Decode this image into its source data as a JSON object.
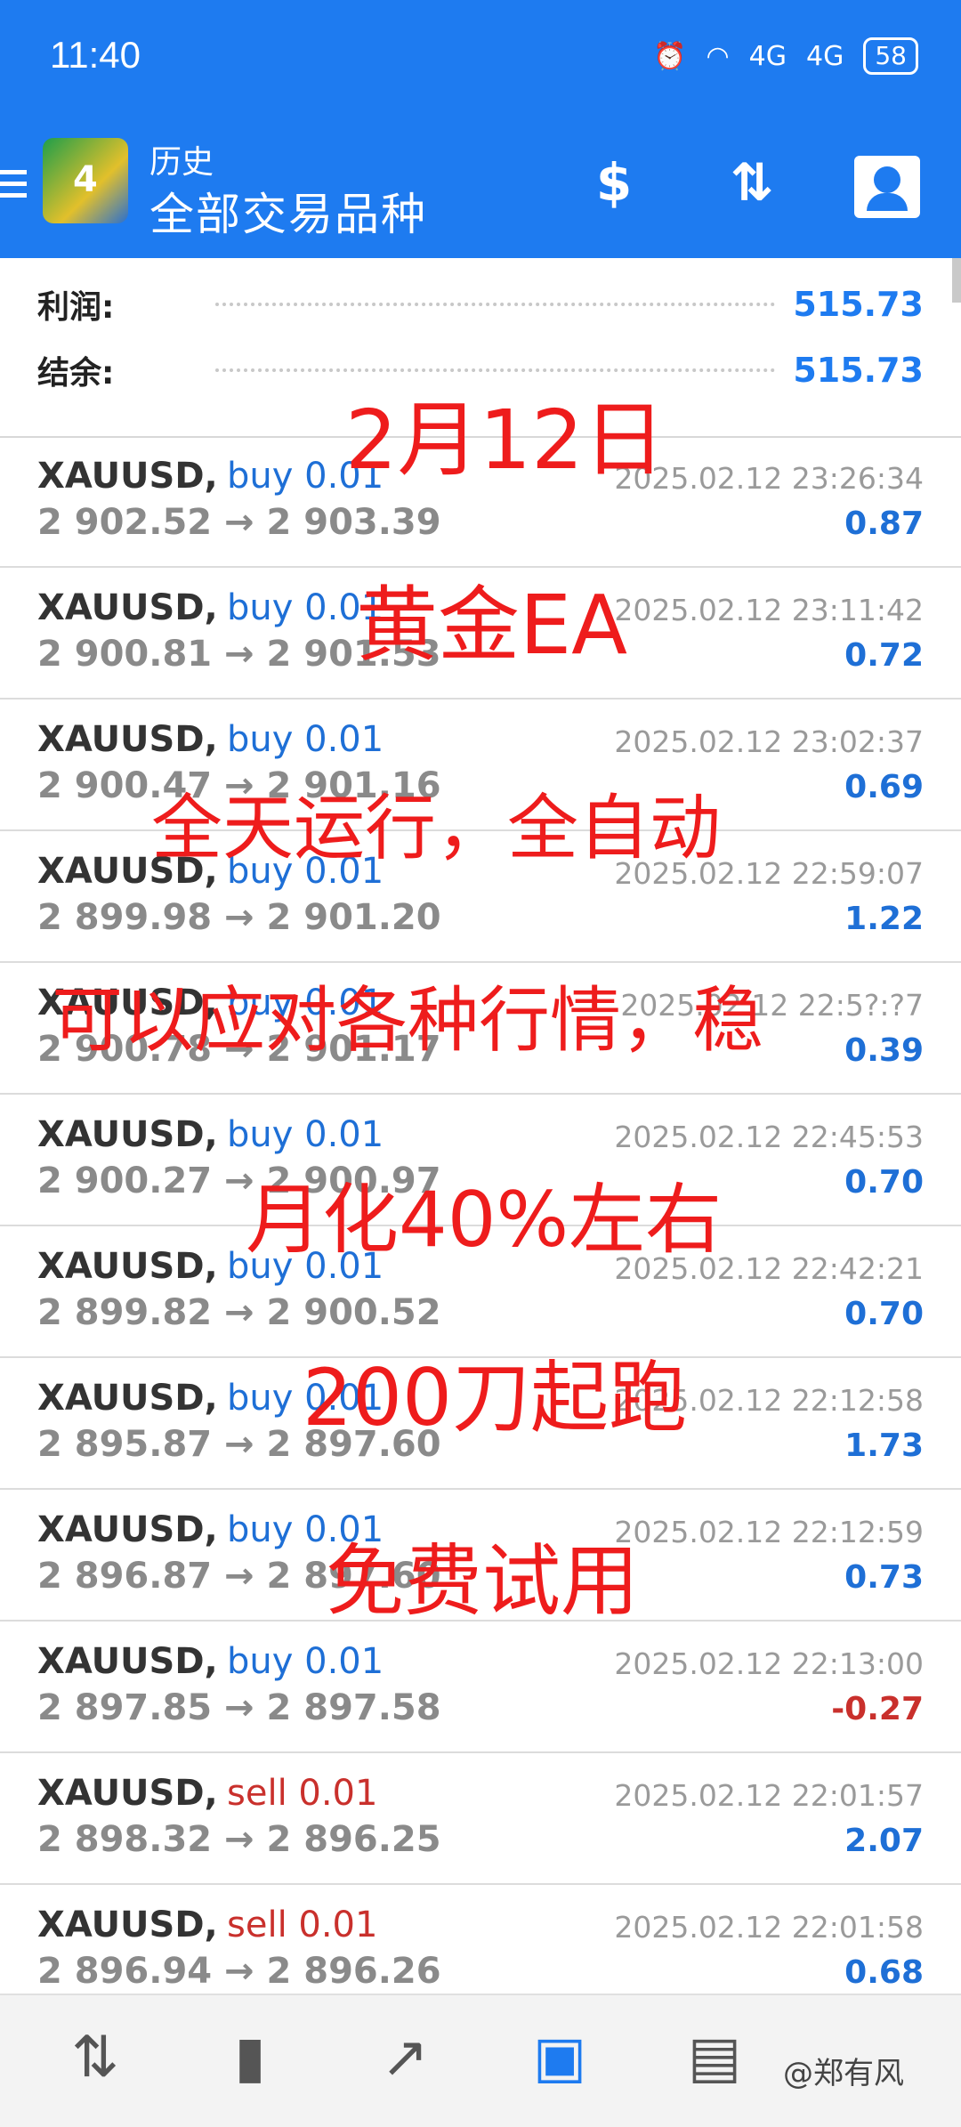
{
  "status": {
    "time": "11:40",
    "signal1": "4G",
    "signal2": "4G",
    "battery": "58"
  },
  "header": {
    "subtitle": "历史",
    "title": "全部交易品种"
  },
  "summary": {
    "profit_label": "利润:",
    "profit_value": "515.73",
    "balance_label": "结余:",
    "balance_value": "515.73"
  },
  "trades": [
    {
      "symbol": "XAUUSD,",
      "side": "buy 0.01",
      "prices": "2 902.52 → 2 903.39",
      "time": "2025.02.12 23:26:34",
      "pl": "0.87"
    },
    {
      "symbol": "XAUUSD,",
      "side": "buy 0.01",
      "prices": "2 900.81 → 2 901.53",
      "time": "2025.02.12 23:11:42",
      "pl": "0.72"
    },
    {
      "symbol": "XAUUSD,",
      "side": "buy 0.01",
      "prices": "2 900.47 → 2 901.16",
      "time": "2025.02.12 23:02:37",
      "pl": "0.69"
    },
    {
      "symbol": "XAUUSD,",
      "side": "buy 0.01",
      "prices": "2 899.98 → 2 901.20",
      "time": "2025.02.12 22:59:07",
      "pl": "1.22"
    },
    {
      "symbol": "XAUUSD,",
      "side": "buy 0.01",
      "prices": "2 900.78 → 2 901.17",
      "time": "2025.02.12 22:5?:?7",
      "pl": "0.39"
    },
    {
      "symbol": "XAUUSD,",
      "side": "buy 0.01",
      "prices": "2 900.27 → 2 900.97",
      "time": "2025.02.12 22:45:53",
      "pl": "0.70"
    },
    {
      "symbol": "XAUUSD,",
      "side": "buy 0.01",
      "prices": "2 899.82 → 2 900.52",
      "time": "2025.02.12 22:42:21",
      "pl": "0.70"
    },
    {
      "symbol": "XAUUSD,",
      "side": "buy 0.01",
      "prices": "2 895.87 → 2 897.60",
      "time": "2025.02.12 22:12:58",
      "pl": "1.73"
    },
    {
      "symbol": "XAUUSD,",
      "side": "buy 0.01",
      "prices": "2 896.87 → 2 897.60",
      "time": "2025.02.12 22:12:59",
      "pl": "0.73"
    },
    {
      "symbol": "XAUUSD,",
      "side": "buy 0.01",
      "prices": "2 897.85 → 2 897.58",
      "time": "2025.02.12 22:13:00",
      "pl": "-0.27"
    },
    {
      "symbol": "XAUUSD,",
      "side": "sell 0.01",
      "prices": "2 898.32 → 2 896.25",
      "time": "2025.02.12 22:01:57",
      "pl": "2.07"
    },
    {
      "symbol": "XAUUSD,",
      "side": "sell 0.01",
      "prices": "2 896.94 → 2 896.26",
      "time": "2025.02.12 22:01:58",
      "pl": "0.68"
    }
  ],
  "overlay": {
    "line1": "2月12日",
    "line2": "黄金EA",
    "line3": "全天运行，全自动",
    "line4": "可以应对各种行情，稳",
    "line5": "月化40%左右",
    "line6": "200刀起跑",
    "line7": "免费试用"
  },
  "nav": {
    "watermark": "@郑有风"
  },
  "colors": {
    "brand": "#1e7bf0",
    "profit": "#1e6fd6",
    "loss": "#c9302c",
    "overlay": "#ee1c1c"
  }
}
